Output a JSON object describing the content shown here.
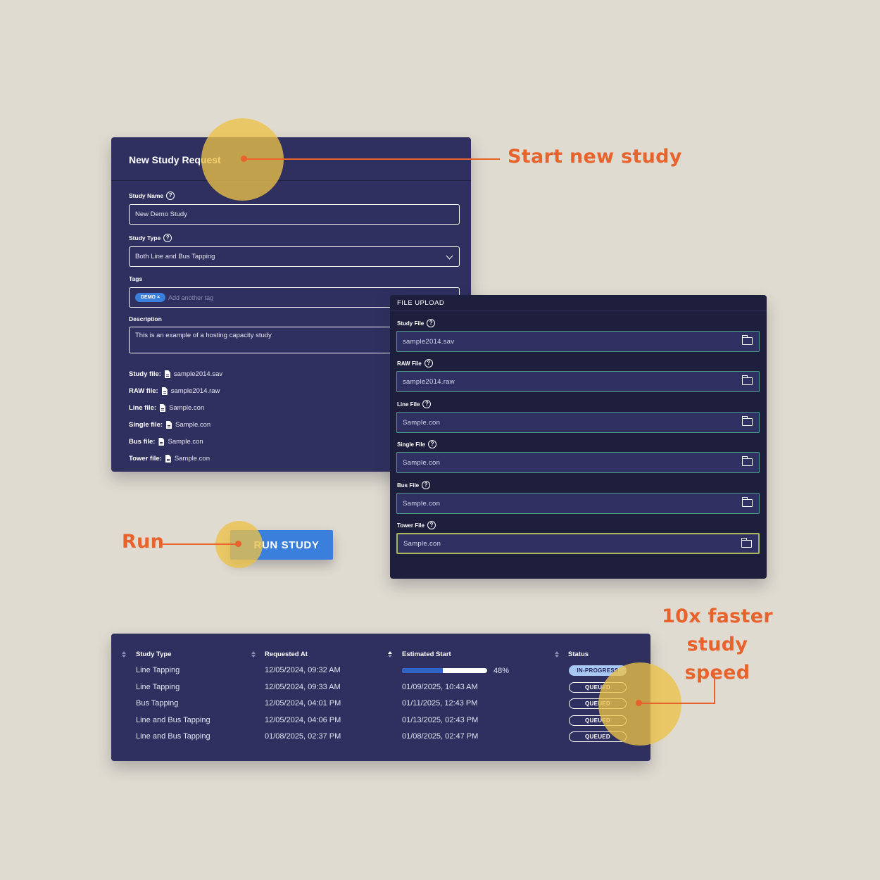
{
  "study_form": {
    "title": "New Study Request",
    "study_name_label": "Study Name",
    "study_name_value": "New Demo Study",
    "study_type_label": "Study Type",
    "study_type_value": "Both Line and Bus Tapping",
    "tags_label": "Tags",
    "tag_chip": "DEMO ×",
    "tag_placeholder": "Add another tag",
    "description_label": "Description",
    "description_value": "This is an example of a hosting capacity study",
    "files": [
      {
        "label": "Study file:",
        "name": "sample2014.sav"
      },
      {
        "label": "RAW file:",
        "name": "sample2014.raw"
      },
      {
        "label": "Line file:",
        "name": "Sample.con"
      },
      {
        "label": "Single file:",
        "name": "Sample.con"
      },
      {
        "label": "Bus file:",
        "name": "Sample.con"
      },
      {
        "label": "Tower file:",
        "name": "Sample.con"
      }
    ]
  },
  "file_upload": {
    "heading": "FILE UPLOAD",
    "fields": [
      {
        "label": "Study File",
        "value": "sample2014.sav"
      },
      {
        "label": "RAW File",
        "value": "sample2014.raw"
      },
      {
        "label": "Line File",
        "value": "Sample.con"
      },
      {
        "label": "Single File",
        "value": "Sample.con"
      },
      {
        "label": "Bus File",
        "value": "Sample.con"
      },
      {
        "label": "Tower File",
        "value": "Sample.con"
      }
    ]
  },
  "run_button_label": "RUN STUDY",
  "queue": {
    "columns": [
      "Study Type",
      "Requested At",
      "Estimated Start",
      "Status"
    ],
    "rows": [
      {
        "type": "Line Tapping",
        "requested": "12/05/2024, 09:32 AM",
        "progress_label": "48%",
        "progress": 0.48,
        "status": "IN-PROGRESS"
      },
      {
        "type": "Line Tapping",
        "requested": "12/05/2024, 09:33 AM",
        "start": "01/09/2025, 10:43 AM",
        "status": "QUEUED"
      },
      {
        "type": "Bus Tapping",
        "requested": "12/05/2024, 04:01 PM",
        "start": "01/11/2025, 12:43 PM",
        "status": "QUEUED"
      },
      {
        "type": "Line and Bus Tapping",
        "requested": "12/05/2024, 04:06 PM",
        "start": "01/13/2025, 02:43 PM",
        "status": "QUEUED"
      },
      {
        "type": "Line and Bus Tapping",
        "requested": "01/08/2025, 02:37 PM",
        "start": "01/08/2025, 02:47 PM",
        "status": "QUEUED"
      }
    ]
  },
  "callouts": {
    "start": "Start new study",
    "run": "Run",
    "speed_line1": "10x faster",
    "speed_line2": "study",
    "speed_line3": "speed"
  },
  "colors": {
    "background": "#e0dbd0",
    "panel": "#2f3060",
    "upload_panel": "#1e1f3d",
    "accent_blue": "#3a7fdc",
    "callout_orange": "#e8622c",
    "highlight_yellow": "#ecc248"
  }
}
